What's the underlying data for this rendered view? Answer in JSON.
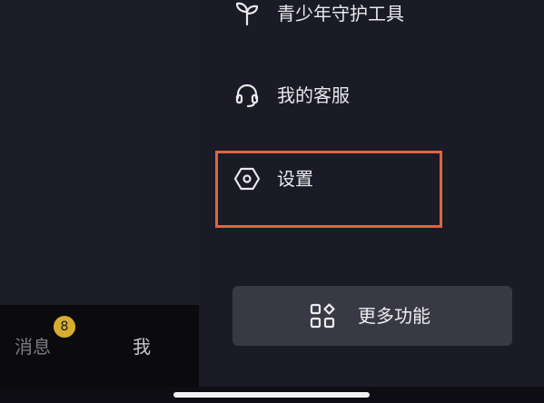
{
  "drawer": {
    "items": [
      {
        "label": "青少年守护工具",
        "icon": "sprout-icon"
      },
      {
        "label": "我的客服",
        "icon": "headset-icon"
      },
      {
        "label": "设置",
        "icon": "settings-hexagon-icon"
      }
    ],
    "more_button": {
      "label": "更多功能",
      "icon": "grid-shapes-icon"
    }
  },
  "tabbar": {
    "messages_label": "消息",
    "messages_badge": "8",
    "me_label": "我"
  },
  "colors": {
    "highlight": "#e0643f",
    "badge": "#d8ad2f"
  }
}
